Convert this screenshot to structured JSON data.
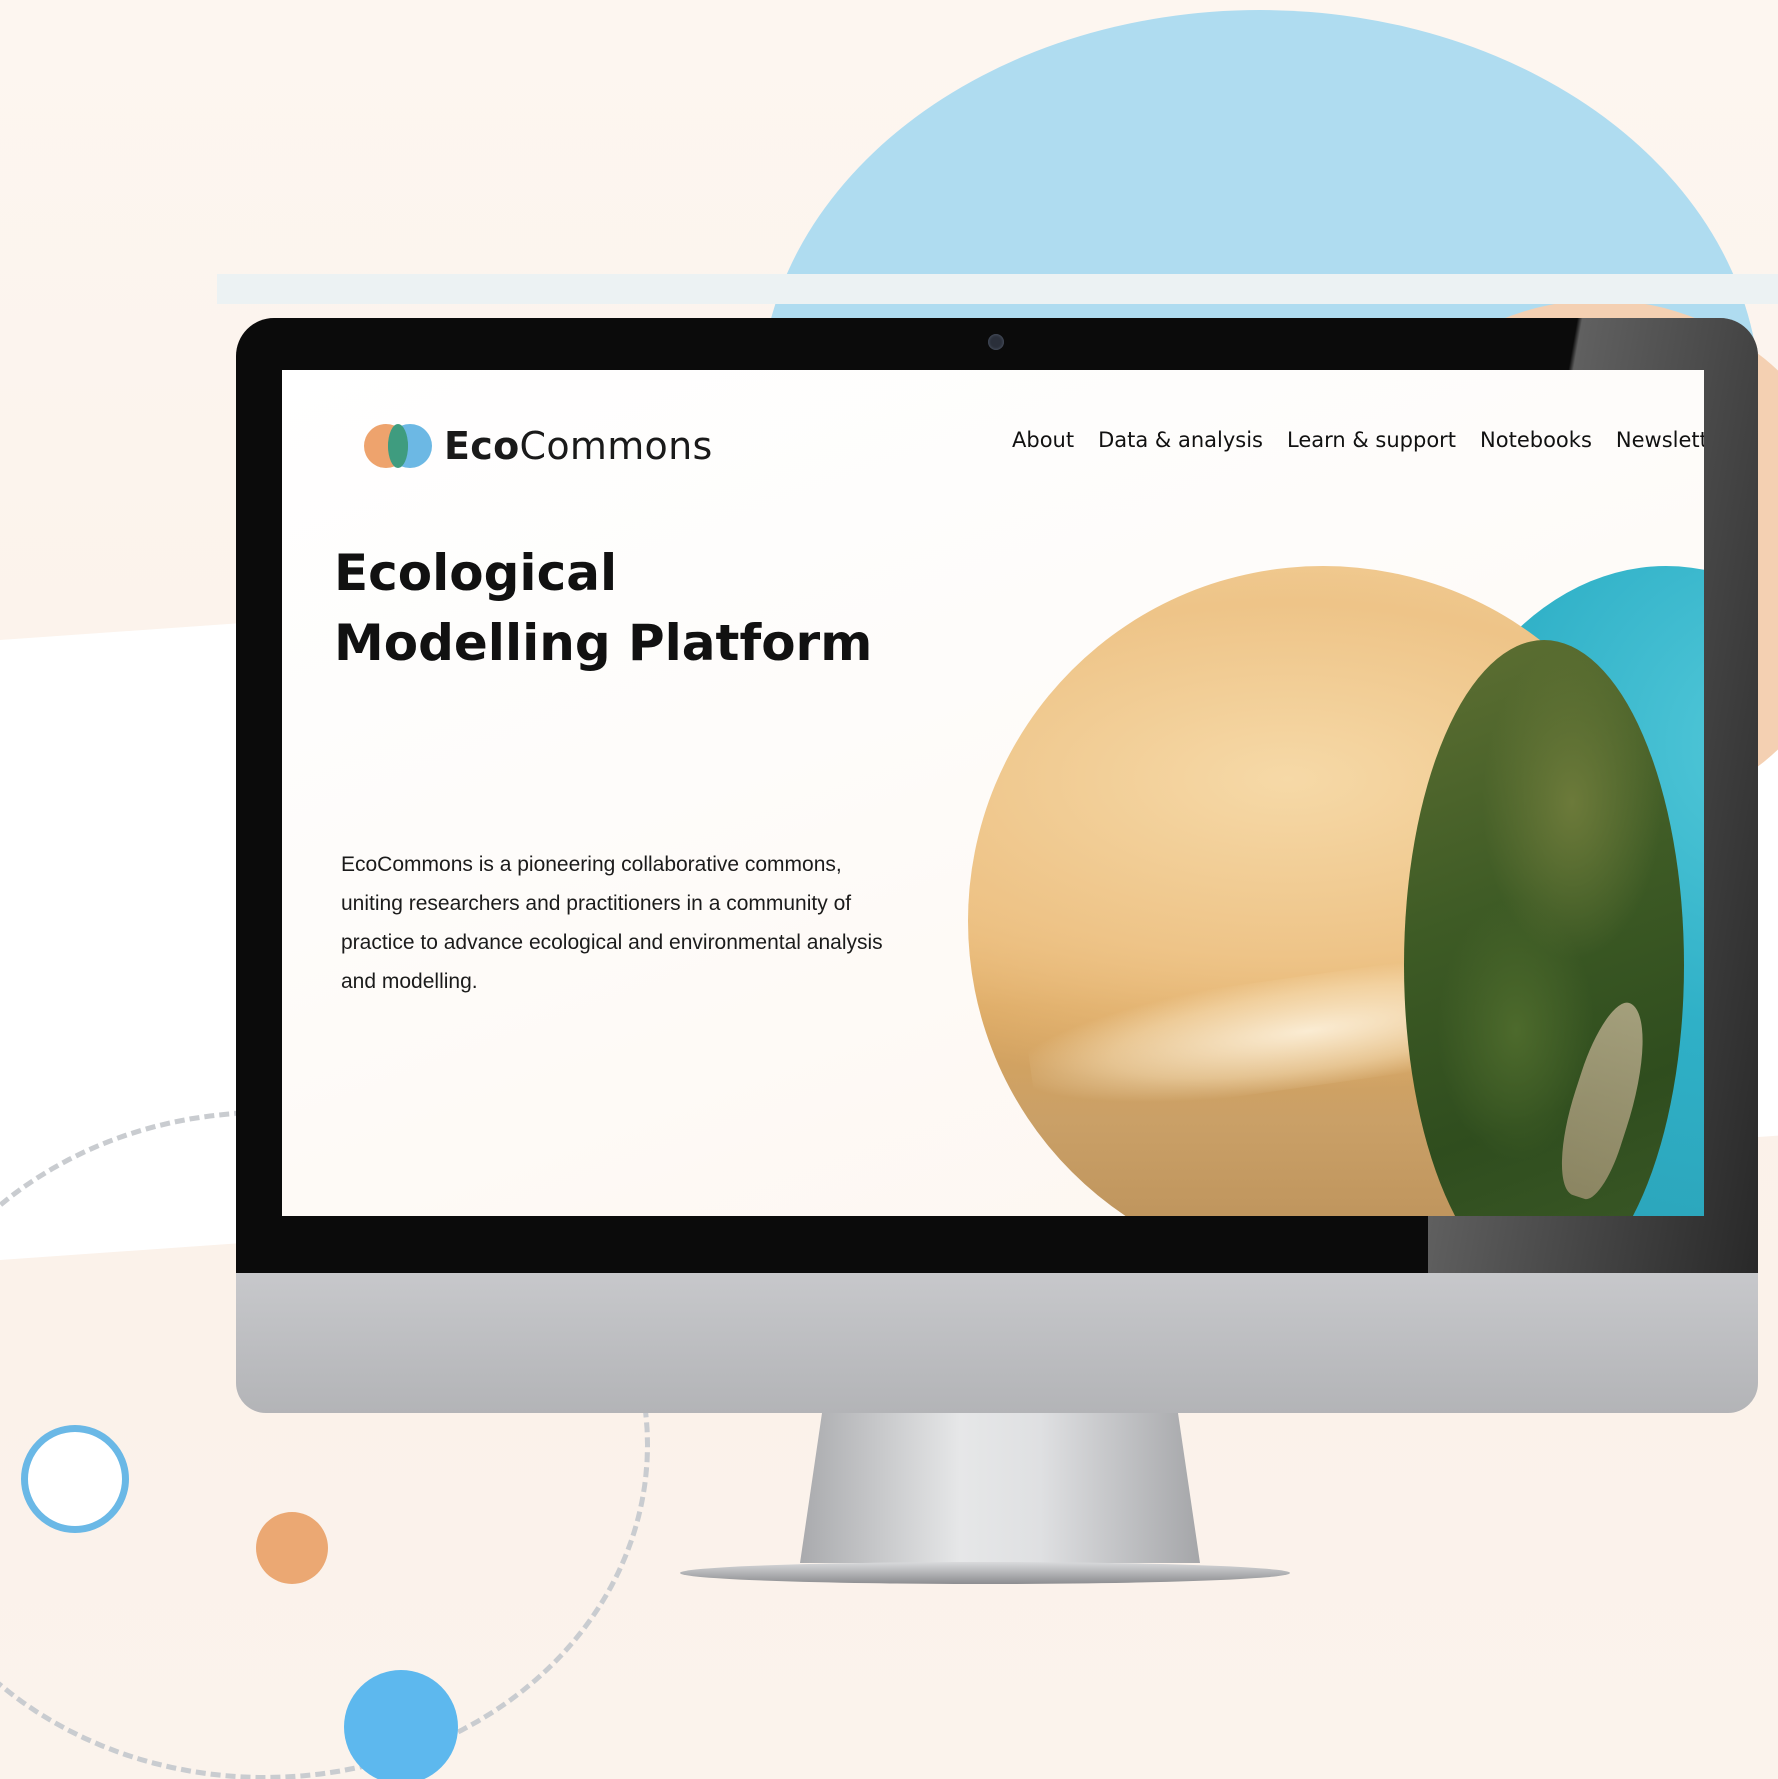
{
  "site": {
    "logo": {
      "bold_part": "Eco",
      "light_part": "Commons"
    },
    "nav": {
      "items": [
        {
          "label": "About"
        },
        {
          "label": "Data & analysis"
        },
        {
          "label": "Learn & support"
        },
        {
          "label": "Notebooks"
        },
        {
          "label": "Newslett"
        }
      ]
    },
    "hero": {
      "title": "Ecological Modelling Platform",
      "description": "EcoCommons is a pioneering collaborative commons, uniting researchers and practitioners in a community of practice to advance ecological and environmental analysis and modelling."
    }
  },
  "colors": {
    "accent_blue": "#6cb9e5",
    "accent_orange": "#eea36d",
    "accent_green": "#3f9c7f"
  },
  "icons": {
    "logo": "ecocommons-logo-icon"
  }
}
